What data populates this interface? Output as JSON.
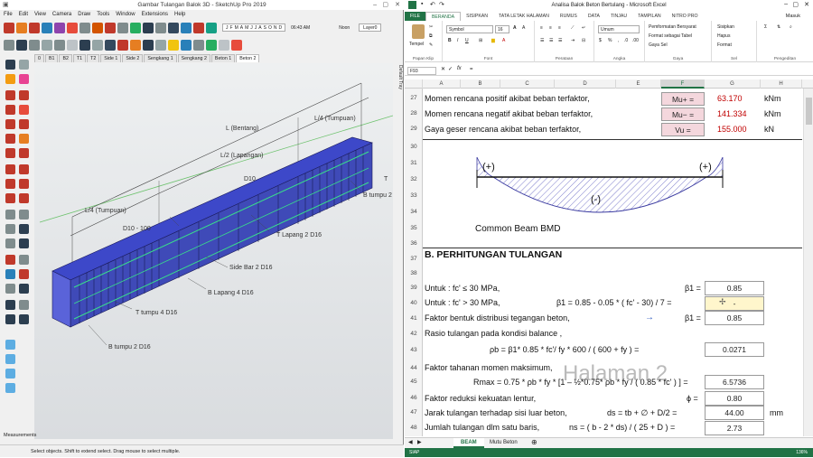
{
  "sketchup": {
    "title": "Gambar Tulangan Balok 3D - SketchUp Pro 2019",
    "menu": [
      "File",
      "Edit",
      "View",
      "Camera",
      "Draw",
      "Tools",
      "Window",
      "Extensions",
      "Help"
    ],
    "months": [
      "J",
      "F",
      "M",
      "A",
      "M",
      "J",
      "J",
      "A",
      "S",
      "O",
      "N",
      "D"
    ],
    "time": "06:43 AM",
    "noon": "Noon",
    "layer": "Layer0",
    "scene_tabs": [
      "0",
      "B1",
      "B2",
      "T1",
      "T2",
      "Side 1",
      "Side 2",
      "Sengkang 1",
      "Sengkang 2",
      "Beton 1",
      "Beton 2"
    ],
    "default_tray": "Default Tray",
    "labels": {
      "bentang": "L (Bentang)",
      "tumpuan_r": "L/4 (Tumpuan)",
      "lapangan": "L/2 (Lapangan)",
      "tumpuan_l": "L/4 (Tumpuan)",
      "d10_a": "D10 - 100",
      "d10_b": "D10",
      "t_tumpu_r": "T",
      "b_tumpu_r": "B tumpu 2",
      "t_lapang": "T Lapang 2 D16",
      "side_bar": "Side Bar 2 D16",
      "b_lapang": "B Lapang 4 D16",
      "t_tumpu": "T tumpu 4 D16",
      "b_tumpu": "B tumpu 2 D16"
    },
    "measurements_label": "Measurements",
    "status": "Select objects. Shift to extend select. Drag mouse to select multiple."
  },
  "excel": {
    "title": "Analisa Balok Beton Bertulang - Microsoft Excel",
    "sign_in": "Masuk",
    "tabs": [
      "FILE",
      "BERANDA",
      "SISIPKAN",
      "TATA LETAK HALAMAN",
      "RUMUS",
      "DATA",
      "TINJAU",
      "TAMPILAN",
      "NITRO PRO"
    ],
    "ribbon": {
      "paste": "Tempel",
      "font_name": "Symbol",
      "font_size": "16",
      "number_format": "Umum",
      "cond_format": "Pemformatan Bersyarat",
      "format_table": "Format sebagai Tabel",
      "cell_styles": "Gaya Sel",
      "insert": "Sisipkan",
      "delete": "Hapus",
      "format": "Format",
      "groups": [
        "Papan Klip",
        "Font",
        "Perataan",
        "Angka",
        "Gaya",
        "Sel",
        "Pengeditan"
      ]
    },
    "name_box": "F93",
    "formula_value": "=",
    "columns": [
      "A",
      "B",
      "C",
      "D",
      "E",
      "F",
      "G",
      "H"
    ],
    "selected_col": "F",
    "rows": [
      "27",
      "28",
      "29",
      "30",
      "31",
      "32",
      "33",
      "34",
      "35",
      "36",
      "37",
      "38",
      "39",
      "40",
      "41",
      "42",
      "43",
      "44",
      "45",
      "46",
      "47",
      "48"
    ],
    "cells": {
      "r27_label": "Momen rencana positif akibat beban terfaktor,",
      "r27_sym": "Mu+ =",
      "r27_val": "63.170",
      "r27_unit": "kNm",
      "r28_label": "Momen rencana negatif akibat beban terfaktor,",
      "r28_sym": "Mu− =",
      "r28_val": "141.334",
      "r28_unit": "kNm",
      "r29_label": "Gaya geser rencana akibat beban terfaktor,",
      "r29_sym": "Vu =",
      "r29_val": "155.000",
      "r29_unit": "kN",
      "bmd_plus_l": "(+)",
      "bmd_plus_r": "(+)",
      "bmd_minus": "(-)",
      "bmd_caption": "Common Beam BMD",
      "section_b": "B. PERHITUNGAN TULANGAN",
      "r39_label": "Untuk  :  fc' ≤ 30 MPa,",
      "r39_sym": "β1 =",
      "r39_val": "0.85",
      "r40_label": "Untuk  :  fc' > 30 MPa,",
      "r40_formula": "β1 = 0.85 - 0.05 * ( fc' - 30) / 7 =",
      "r40_val": "-",
      "r41_label": "Faktor bentuk distribusi tegangan beton,",
      "r41_sym": "β1 =",
      "r41_val": "0.85",
      "r42_label": "Rasio tulangan pada kondisi balance ,",
      "r43_formula": "ρb = β1* 0.85 * fc'/ fy * 600 / ( 600 + fy ) =",
      "r43_val": "0.0271",
      "r44_label": "Faktor tahanan momen maksimum,",
      "r45_formula": "Rmax = 0.75 * ρb * fy * [1 – ½*0.75* ρb * fy / ( 0.85 * fc' ) ] =",
      "r45_val": "6.5736",
      "r46_label": "Faktor reduksi kekuatan lentur,",
      "r46_sym": "ϕ =",
      "r46_val": "0.80",
      "r47_label": "Jarak tulangan terhadap sisi luar beton,",
      "r47_formula": "ds = tb + ∅ + D/2 =",
      "r47_val": "44.00",
      "r47_unit": "mm",
      "r48_label": "Jumlah tulangan dlm satu baris,",
      "r48_formula": "ns = ( b - 2 * ds) / ( 25 + D ) =",
      "r48_val": "2.73"
    },
    "watermark": "Halaman 2",
    "sheet_tabs": [
      "BEAM",
      "Mutu Beton"
    ],
    "status": "SIAP",
    "zoom": "136%"
  }
}
